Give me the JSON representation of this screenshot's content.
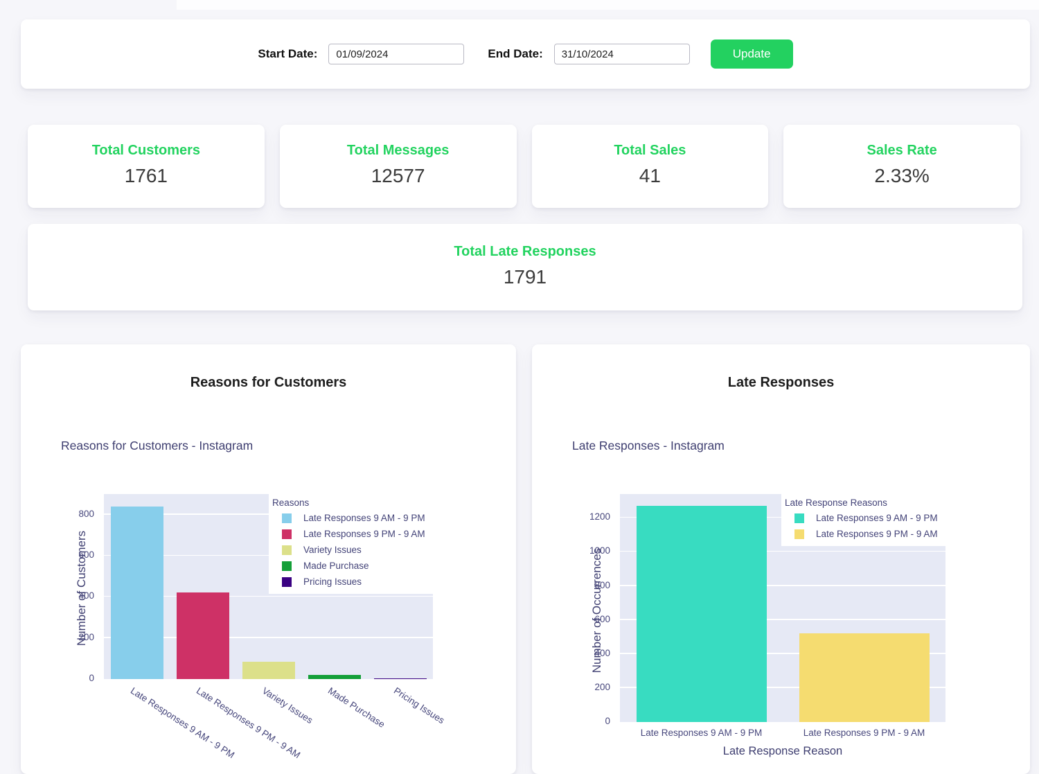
{
  "colors": {
    "accent_green": "#22d35f",
    "button_green": "#23d160",
    "page_background": "#f6f6fa",
    "plot_background": "#e6e9f5",
    "axis_text": "#47477c",
    "value_text": "#3b3b3b"
  },
  "filters": {
    "start_date_label": "Start Date:",
    "start_date_value": "01/09/2024",
    "end_date_label": "End Date:",
    "end_date_value": "31/10/2024",
    "update_label": "Update"
  },
  "stats": [
    {
      "title": "Total Customers",
      "value": "1761"
    },
    {
      "title": "Total Messages",
      "value": "12577"
    },
    {
      "title": "Total Sales",
      "value": "41"
    },
    {
      "title": "Sales Rate",
      "value": "2.33%"
    }
  ],
  "late_summary": {
    "title": "Total Late Responses",
    "value": "1791"
  },
  "panels": [
    {
      "title": "Reasons for Customers"
    },
    {
      "title": "Late Responses"
    }
  ],
  "chart_data": [
    {
      "type": "bar",
      "title": "Reasons for Customers - Instagram",
      "xlabel": "",
      "ylabel": "Number of Customers",
      "legend_title": "Reasons",
      "legend_position": "top-right-inside",
      "grid": true,
      "ylim": [
        0,
        900
      ],
      "yticks": [
        0,
        200,
        400,
        600,
        800
      ],
      "categories": [
        "Late Responses 9 AM - 9 PM",
        "Late Responses 9 PM - 9 AM",
        "Variety Issues",
        "Made Purchase",
        "Pricing Issues"
      ],
      "values": [
        840,
        420,
        85,
        20,
        5
      ],
      "colors": [
        "#87CEEB",
        "#CE3166",
        "#DCE08A",
        "#149F38",
        "#3A0182"
      ],
      "xtick_rotation": 33
    },
    {
      "type": "bar",
      "title": "Late Responses - Instagram",
      "xlabel": "Late Response Reason",
      "ylabel": "Number of Occurrences",
      "legend_title": "Late Response Reasons",
      "legend_position": "top-right-inside",
      "grid": true,
      "ylim": [
        0,
        1340
      ],
      "yticks": [
        0,
        200,
        400,
        600,
        800,
        1000,
        1200
      ],
      "categories": [
        "Late Responses 9 AM - 9 PM",
        "Late Responses 9 PM - 9 AM"
      ],
      "values": [
        1270,
        521
      ],
      "colors": [
        "#38DCC1",
        "#F5DC70"
      ],
      "xtick_rotation": 0
    }
  ]
}
